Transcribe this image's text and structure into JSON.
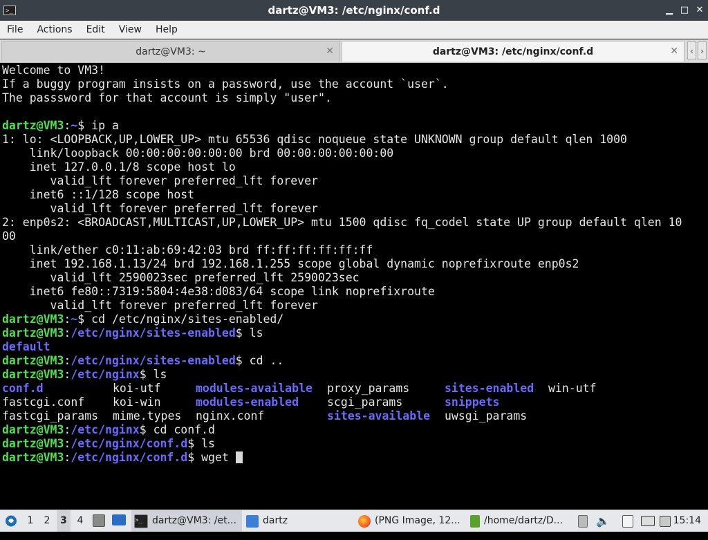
{
  "window": {
    "title": "dartz@VM3: /etc/nginx/conf.d",
    "controls": {
      "minimize": "▁",
      "maximize": "□",
      "close": "✕"
    }
  },
  "menubar": [
    "File",
    "Actions",
    "Edit",
    "View",
    "Help"
  ],
  "tabs": [
    {
      "label": "dartz@VM3: ~",
      "active": false
    },
    {
      "label": "dartz@VM3: /etc/nginx/conf.d",
      "active": true
    }
  ],
  "terminal": {
    "plain_lines": [
      "Welcome to VM3!",
      "If a buggy program insists on a password, use the account `user`.",
      "The passsword for that account is simply \"user\".",
      "",
      "1: lo: <LOOPBACK,UP,LOWER_UP> mtu 65536 qdisc noqueue state UNKNOWN group default qlen 1000",
      "    link/loopback 00:00:00:00:00:00 brd 00:00:00:00:00:00",
      "    inet 127.0.0.1/8 scope host lo",
      "       valid_lft forever preferred_lft forever",
      "    inet6 ::1/128 scope host",
      "       valid_lft forever preferred_lft forever",
      "2: enp0s2: <BROADCAST,MULTICAST,UP,LOWER_UP> mtu 1500 qdisc fq_codel state UP group default qlen 10",
      "00",
      "    link/ether c0:11:ab:69:42:03 brd ff:ff:ff:ff:ff:ff",
      "    inet 192.168.1.13/24 brd 192.168.1.255 scope global dynamic noprefixroute enp0s2",
      "       valid_lft 2590023sec preferred_lft 2590023sec",
      "    inet6 fe80::7319:5804:4e38:d083/64 scope link noprefixroute",
      "       valid_lft forever preferred_lft forever"
    ],
    "prompt_user": "dartz@VM3",
    "prompts": [
      {
        "path": "~",
        "cmd": "ip a"
      },
      {
        "path": "~",
        "cmd": "cd /etc/nginx/sites-enabled/"
      },
      {
        "path": "/etc/nginx/sites-enabled",
        "cmd": "ls"
      },
      {
        "path": "/etc/nginx/sites-enabled",
        "cmd": "cd .."
      },
      {
        "path": "/etc/nginx",
        "cmd": "ls"
      },
      {
        "path": "/etc/nginx",
        "cmd": "cd conf.d"
      },
      {
        "path": "/etc/nginx/conf.d",
        "cmd": "ls"
      },
      {
        "path": "/etc/nginx/conf.d",
        "cmd": "wget "
      }
    ],
    "ls_sites_enabled": "default",
    "ls_nginx": [
      [
        "conf.d",
        "koi-utf",
        "modules-available",
        "proxy_params",
        "sites-enabled",
        "win-utf"
      ],
      [
        "fastcgi.conf",
        "koi-win",
        "modules-enabled",
        "scgi_params",
        "snippets",
        ""
      ],
      [
        "fastcgi_params",
        "mime.types",
        "nginx.conf",
        "sites-available",
        "uwsgi_params",
        ""
      ]
    ],
    "colors": {
      "prompt": "#4de04d",
      "directory": "#6a6aff",
      "text": "#e6e6e6",
      "background": "#000000"
    }
  },
  "taskbar": {
    "workspaces": [
      "1",
      "2",
      "3",
      "4"
    ],
    "current_workspace": "3",
    "tasks": [
      {
        "label": "dartz@VM3: /et...",
        "icon": "terminal-icon"
      },
      {
        "label": "dartz",
        "icon": "folder-icon"
      },
      {
        "label": "(PNG Image, 12...",
        "icon": "firefox-icon"
      },
      {
        "label": "/home/dartz/D...",
        "icon": "text-editor-icon"
      }
    ],
    "clock": "15:14"
  }
}
